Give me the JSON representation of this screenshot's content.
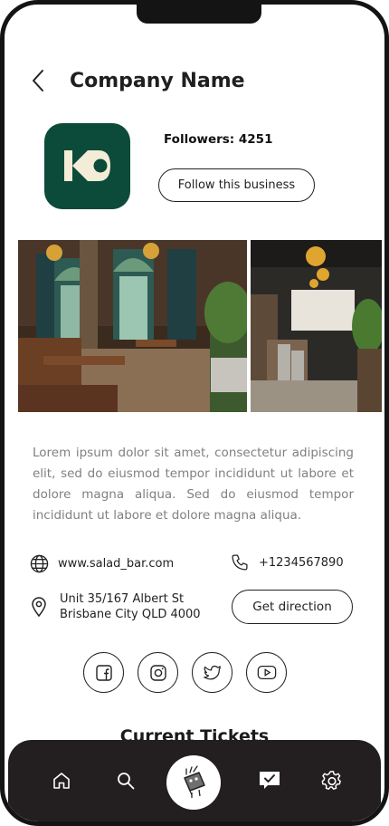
{
  "header": {
    "title": "Company Name"
  },
  "profile": {
    "followers": "Followers: 4251",
    "follow_label": "Follow this business"
  },
  "description": "Lorem ipsum dolor sit amet, consectetur adipiscing elit, sed do eiusmod tempor incididunt ut labore et dolore magna aliqua. Sed do eiusmod tempor incididunt ut labore et dolore magna aliqua.",
  "contact": {
    "website": "www.salad_bar.com",
    "phone": "+1234567890",
    "address_line1": "Unit 35/167 Albert St",
    "address_line2": "Brisbane City QLD  4000",
    "direction_label": "Get direction"
  },
  "social": [
    "facebook-icon",
    "instagram-icon",
    "twitter-icon",
    "youtube-icon"
  ],
  "section": {
    "title": "Current Tickets"
  },
  "tabbar": [
    "home-icon",
    "search-icon",
    "mascot-icon",
    "message-check-icon",
    "settings-gear-icon"
  ],
  "colors": {
    "brand": "#0c4a3a",
    "brand_mark": "#f3ecd6",
    "tabbar": "#231f20",
    "text_muted": "#808080"
  }
}
